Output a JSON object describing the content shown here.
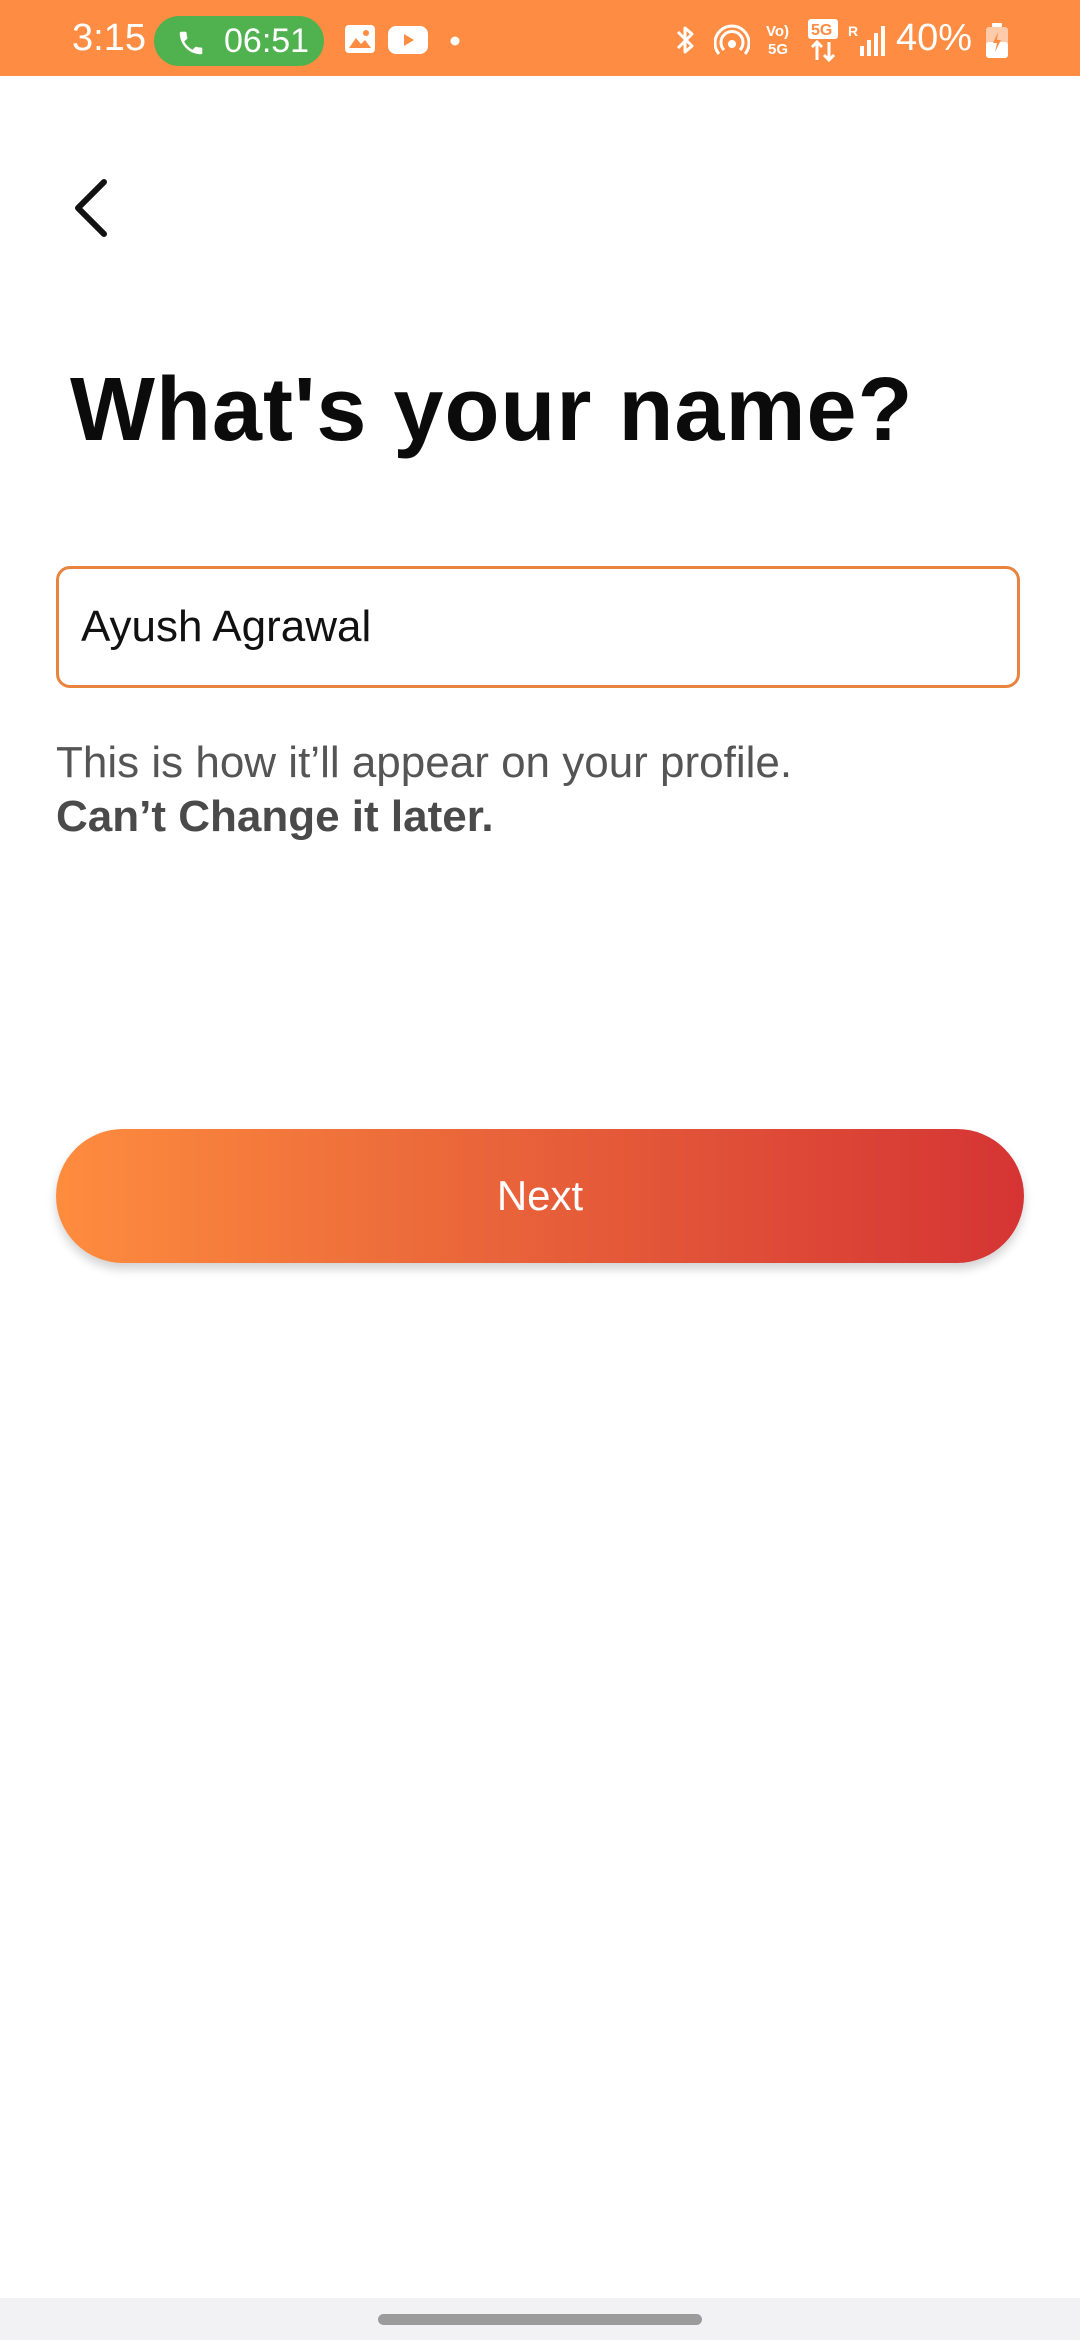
{
  "status_bar": {
    "time": "3:15",
    "call_timer": "06:51",
    "battery": "40%",
    "background_color": "#fe8c43",
    "call_pill_color": "#4fb24e",
    "icons": [
      "phone-icon",
      "gallery-icon",
      "youtube-icon",
      "dot-icon",
      "bluetooth-icon",
      "hotspot-icon",
      "volte-icon",
      "5g-icon",
      "signal-icon",
      "battery-icon"
    ]
  },
  "page": {
    "title": "What's your name?"
  },
  "form": {
    "name_value": "Ayush Agrawal",
    "accent_color": "#e9843f"
  },
  "helper": {
    "line1": "This is how it’ll appear on your profile.",
    "line2": "Can’t Change it later."
  },
  "actions": {
    "next_label": "Next",
    "gradient": [
      "#fe8c3e",
      "#d53434"
    ]
  }
}
